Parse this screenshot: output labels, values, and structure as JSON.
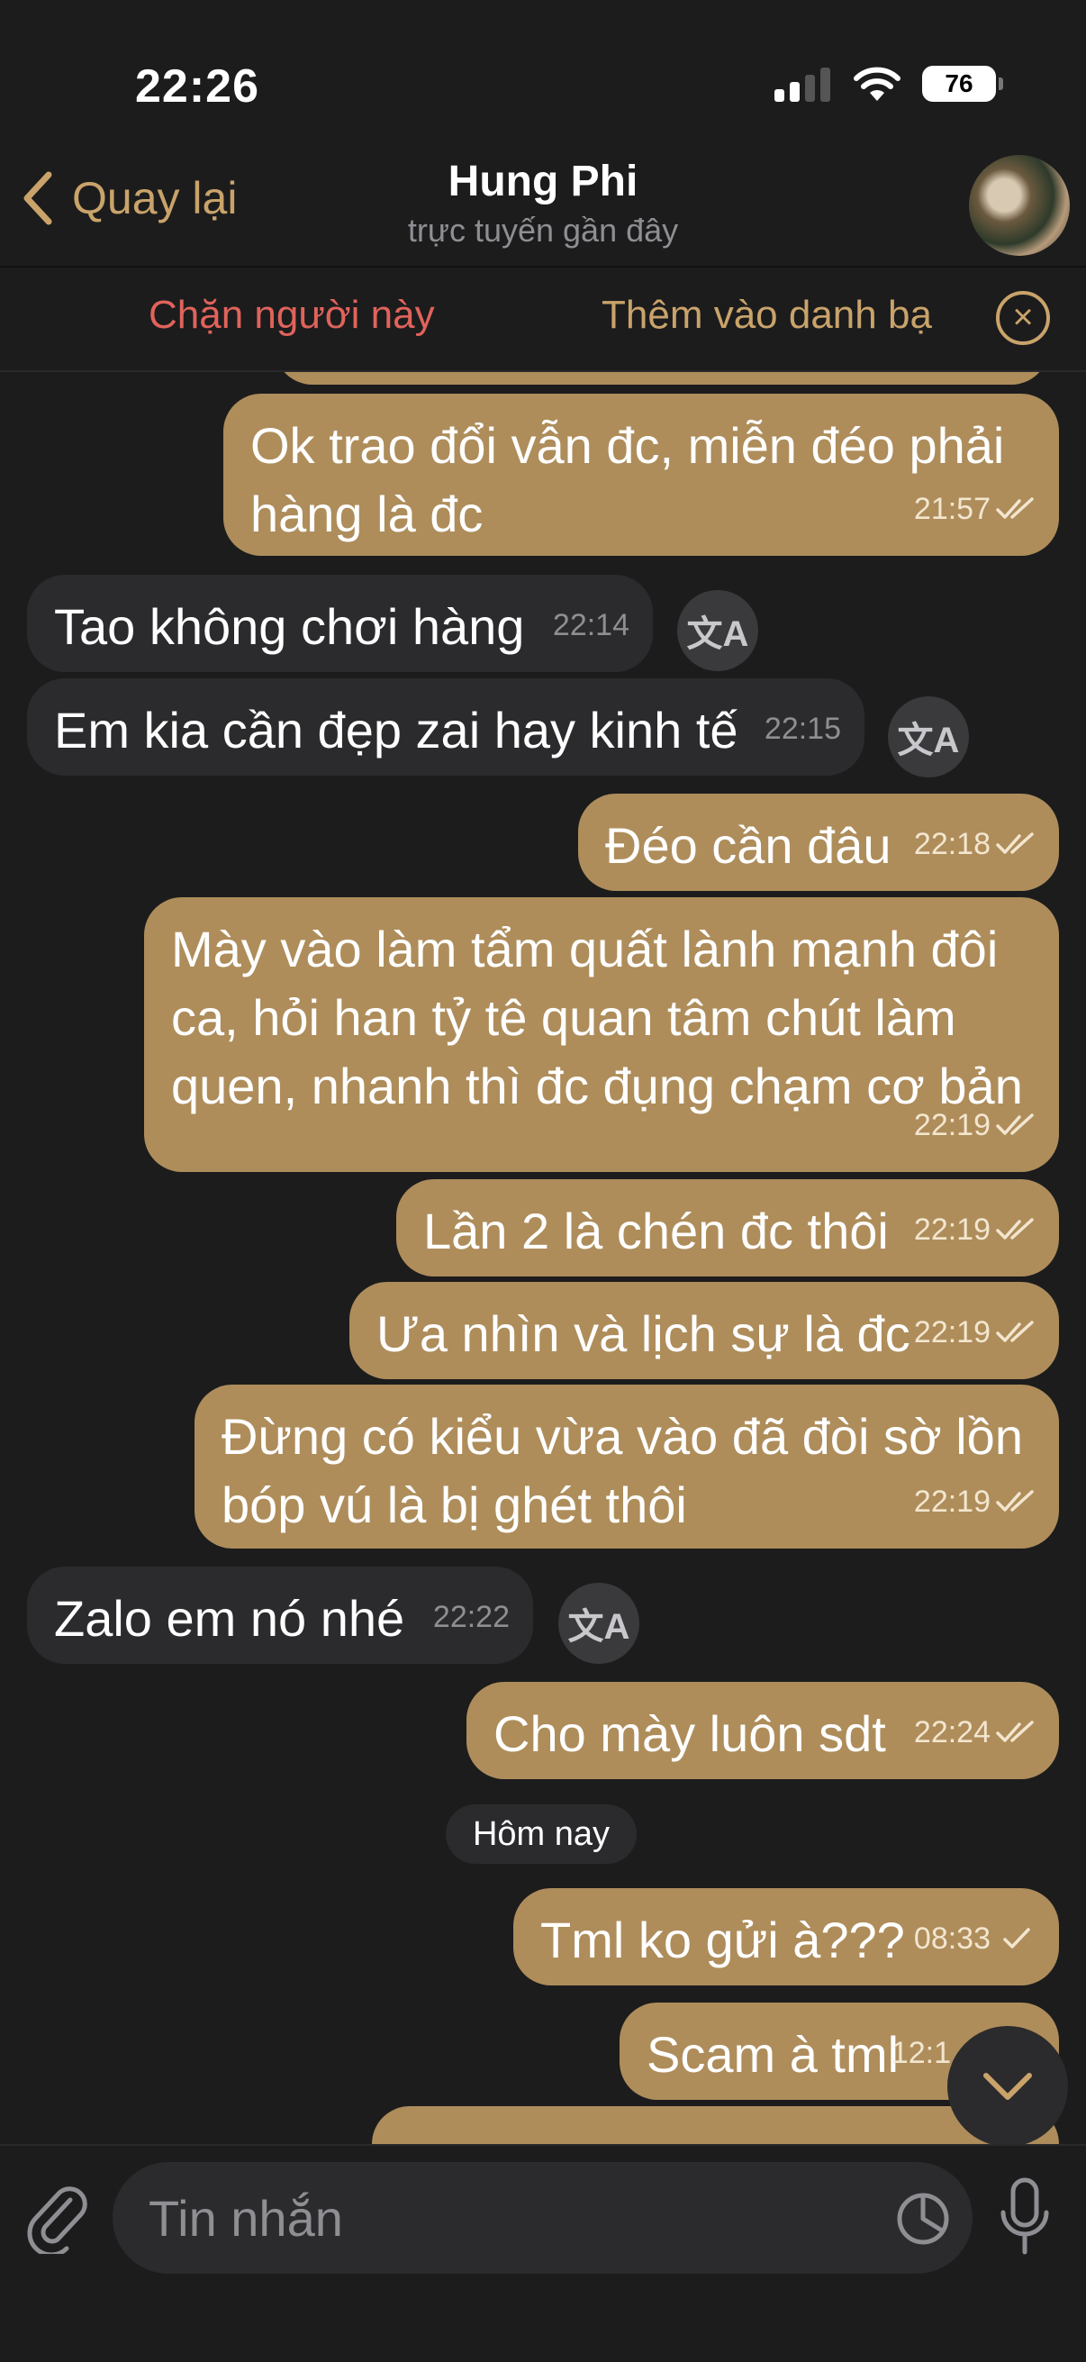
{
  "status_bar": {
    "time": "22:26",
    "battery": "76"
  },
  "header": {
    "back_label": "Quay lại",
    "title": "Hung Phi",
    "subtitle": "trực tuyến gần đây"
  },
  "action_bar": {
    "block_label": "Chặn người này",
    "add_contact_label": "Thêm vào danh bạ"
  },
  "messages": [
    {
      "text": "Ok trao đổi vẫn đc, miễn đéo phải hàng là đc",
      "time": "21:57"
    },
    {
      "text": "Tao không chơi hàng",
      "time": "22:14"
    },
    {
      "text": "Em kia cần đẹp zai hay kinh tế",
      "time": "22:15"
    },
    {
      "text": "Đéo cần đâu",
      "time": "22:18"
    },
    {
      "text": "Mày vào làm tẩm quất lành mạnh đôi ca, hỏi han tỷ tê quan tâm chút làm quen, nhanh thì đc đụng chạm cơ bản",
      "time": "22:19"
    },
    {
      "text": "Lần 2 là chén đc thôi",
      "time": "22:19"
    },
    {
      "text": "Ưa nhìn và lịch sự là đc",
      "time": "22:19"
    },
    {
      "text": "Đừng có kiểu vừa vào đã đòi sờ lồn bóp vú là bị ghét thôi",
      "time": "22:19"
    },
    {
      "text": "Zalo em nó nhé",
      "time": "22:22"
    },
    {
      "text": "Cho mày luôn sdt",
      "time": "22:24"
    },
    {
      "text": "Tml ko gửi à???",
      "time": "08:33"
    },
    {
      "text": "Scam à tml",
      "time": "12:1"
    }
  ],
  "date_separator": "Hôm nay",
  "input": {
    "placeholder": "Tin nhắn"
  },
  "colors": {
    "accent": "#c9a36a",
    "outgoing_bubble": "#ae8d5b",
    "incoming_bubble": "#2b2b2d",
    "block_red": "#e0635b",
    "background": "#1c1c1d"
  },
  "icons": [
    "back-chevron-icon",
    "close-circle-icon",
    "translate-icon",
    "double-check-icon",
    "single-check-icon",
    "scroll-down-icon",
    "paperclip-icon",
    "sticker-icon",
    "microphone-icon"
  ]
}
